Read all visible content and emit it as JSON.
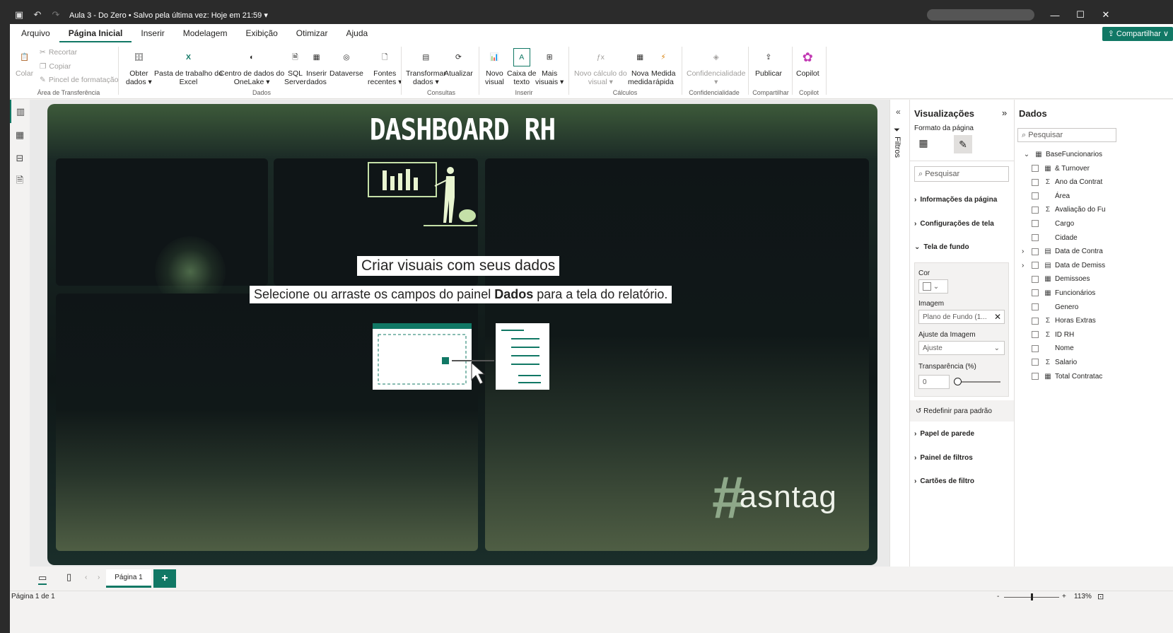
{
  "titlebar": {
    "doc_title": "Aula 3 - Do Zero • Salvo pela última vez: Hoje em 21:59 ▾"
  },
  "menu": {
    "items": [
      "Arquivo",
      "Página Inicial",
      "Inserir",
      "Modelagem",
      "Exibição",
      "Otimizar",
      "Ajuda"
    ],
    "share": "Compartilhar ∨"
  },
  "ribbon": {
    "clipboard": {
      "paste": "Colar",
      "cut": "Recortar",
      "copy": "Copiar",
      "format_painter": "Pincel de formatação",
      "group": "Área de Transferência"
    },
    "data": {
      "get_data": "Obter",
      "get_data2": "dados ▾",
      "excel": "Pasta de trabalho do",
      "excel2": "Excel",
      "onelake": "Centro de dados do",
      "onelake2": "OneLake ▾",
      "sql": "SQL",
      "sql2": "Server",
      "insert_data": "Inserir",
      "insert_data2": "dados",
      "dataverse": "Dataverse",
      "recent": "Fontes",
      "recent2": "recentes ▾",
      "group": "Dados"
    },
    "queries": {
      "transform": "Transformar",
      "transform2": "dados ▾",
      "refresh": "Atualizar",
      "group": "Consultas"
    },
    "insert": {
      "new_visual": "Novo",
      "new_visual2": "visual",
      "text_box": "Caixa de",
      "text_box2": "texto",
      "more_visuals": "Mais",
      "more_visuals2": "visuais ▾",
      "group": "Inserir"
    },
    "calc": {
      "new_calc": "Novo cálculo do",
      "new_calc2": "visual ▾",
      "new_measure": "Nova",
      "new_measure2": "medida",
      "quick_measure": "Medida",
      "quick_measure2": "rápida",
      "group": "Cálculos"
    },
    "sensitivity": {
      "label": "Confidencialidade",
      "label2": "▾",
      "group": "Confidencialidade"
    },
    "share": {
      "publish": "Publicar",
      "group": "Compartilhar"
    },
    "copilot": {
      "label": "Copilot",
      "group": "Copilot"
    }
  },
  "report": {
    "title": "DASHBOARD RH",
    "placeholder_title": "Criar visuais com seus dados",
    "placeholder_sub_1": "Selecione ou arraste os campos do painel ",
    "placeholder_sub_bold": "Dados",
    "placeholder_sub_2": " para a tela do relatório.",
    "logo_text": "asntag"
  },
  "filters": {
    "label": "Filtros"
  },
  "visualizations": {
    "title": "Visualizações",
    "page_format": "Formato da página",
    "search_placeholder": "Pesquisar",
    "sections": [
      "Informações da página",
      "Configurações de tela",
      "Tela de fundo"
    ],
    "bg": {
      "color_label": "Cor",
      "image_label": "Imagem",
      "image_value": "Plano de Fundo (1...",
      "fit_label": "Ajuste da Imagem",
      "fit_value": "Ajuste",
      "transparency_label": "Transparência (%)",
      "transparency_value": "0"
    },
    "reset": "Redefinir para padrão",
    "sections_after": [
      "Papel de parede",
      "Painel de filtros",
      "Cartões de filtro"
    ]
  },
  "data_pane": {
    "title": "Dados",
    "search_placeholder": "Pesquisar",
    "table": "BaseFuncionarios",
    "fields": [
      {
        "name": "& Turnover",
        "icon": "calc"
      },
      {
        "name": "Ano da Contrat",
        "icon": "sum"
      },
      {
        "name": "Área",
        "icon": "none"
      },
      {
        "name": "Avaliação do Fu",
        "icon": "sum"
      },
      {
        "name": "Cargo",
        "icon": "none"
      },
      {
        "name": "Cidade",
        "icon": "none"
      },
      {
        "name": "Data de Contra",
        "icon": "date"
      },
      {
        "name": "Data de Demiss",
        "icon": "date"
      },
      {
        "name": "Demissoes",
        "icon": "calc"
      },
      {
        "name": "Funcionários",
        "icon": "calc"
      },
      {
        "name": "Genero",
        "icon": "none"
      },
      {
        "name": "Horas Extras",
        "icon": "sum"
      },
      {
        "name": "ID RH",
        "icon": "sum"
      },
      {
        "name": "Nome",
        "icon": "none"
      },
      {
        "name": "Salario",
        "icon": "sum"
      },
      {
        "name": "Total Contratac",
        "icon": "calc"
      }
    ]
  },
  "pages": {
    "tab": "Página 1",
    "add": "+"
  },
  "status": {
    "page": "Página 1 de 1",
    "zoom": "113%"
  },
  "colors": {
    "accent": "#117865",
    "title_bar": "#2b2b2b"
  }
}
